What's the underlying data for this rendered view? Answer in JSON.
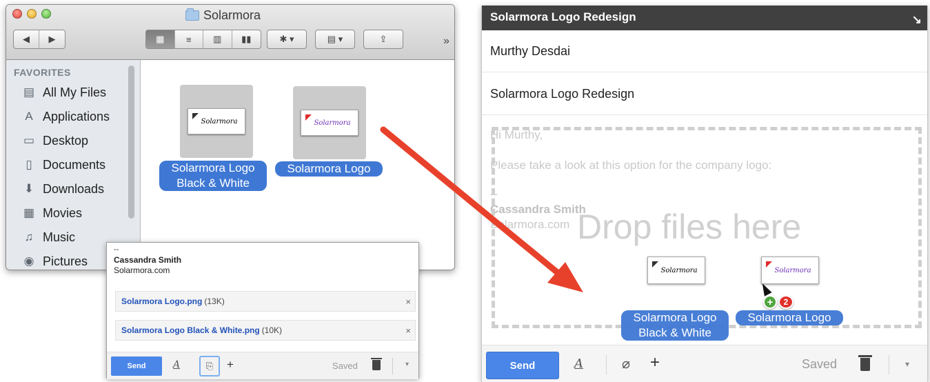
{
  "finder": {
    "title": "Solarmora",
    "sidebar_heading": "FAVORITES",
    "sidebar_items": [
      {
        "label": "All My Files",
        "icon": "all-files-icon",
        "glyph": "▤"
      },
      {
        "label": "Applications",
        "icon": "applications-icon",
        "glyph": "A"
      },
      {
        "label": "Desktop",
        "icon": "desktop-icon",
        "glyph": "▭"
      },
      {
        "label": "Documents",
        "icon": "documents-icon",
        "glyph": "▯"
      },
      {
        "label": "Downloads",
        "icon": "downloads-icon",
        "glyph": "⬇"
      },
      {
        "label": "Movies",
        "icon": "movies-icon",
        "glyph": "▦"
      },
      {
        "label": "Music",
        "icon": "music-icon",
        "glyph": "♫"
      },
      {
        "label": "Pictures",
        "icon": "pictures-icon",
        "glyph": "◉"
      }
    ],
    "files": [
      {
        "label_line1": "Solarmora Logo",
        "label_line2": "Black & White",
        "thumb_text": "Solarmora",
        "variant": "bw"
      },
      {
        "label_line1": "Solarmora Logo",
        "thumb_text": "Solarmora",
        "variant": "color"
      }
    ],
    "toolbar": {
      "back_glyph": "◀",
      "forward_glyph": "▶",
      "view_icons": [
        "▦",
        "≡",
        "▥",
        "▮▮"
      ],
      "action_glyph": "✱ ▾",
      "arrange_glyph": "▤ ▾",
      "share_glyph": "⇪",
      "overflow_glyph": "»"
    }
  },
  "popup": {
    "dash": "--",
    "signature_name": "Cassandra Smith",
    "signature_site": "Solarmora.com",
    "attachments": [
      {
        "name": "Solarmora Logo.png",
        "size": "(13K)"
      },
      {
        "name": "Solarmora Logo Black & White.png",
        "size": "(10K)"
      }
    ],
    "close_glyph": "×",
    "send_label": "Send",
    "format_glyph": "A",
    "attach_glyph": "⎘",
    "plus_glyph": "+",
    "saved_label": "Saved",
    "more_glyph": "▾"
  },
  "compose": {
    "title": "Solarmora Logo Redesign",
    "expand_glyph": "↘",
    "to": "Murthy Desdai",
    "subject": "Solarmora Logo Redesign",
    "greeting": "Hi Murthy,",
    "body": "Please take a look at this option for the company logo:",
    "dash": "--",
    "signature_name": "Cassandra Smith",
    "signature_site": "Solarmora.com",
    "drop_text": "Drop files here",
    "drag_labels": [
      {
        "line1": "Solarmora Logo",
        "line2": "Black & White"
      },
      {
        "line1": "Solarmora Logo"
      }
    ],
    "thumb_text": "Solarmora",
    "plus_badge": "+",
    "count_badge": "2",
    "send_label": "Send",
    "format_glyph": "A",
    "attach_glyph": "⌀",
    "plus_glyph": "+",
    "saved_label": "Saved",
    "more_glyph": "▾"
  },
  "colors": {
    "accent_blue": "#4a86e8",
    "selection_blue": "#3f78d4",
    "arrow_red": "#e8412b",
    "compose_title_bg": "#404040"
  }
}
